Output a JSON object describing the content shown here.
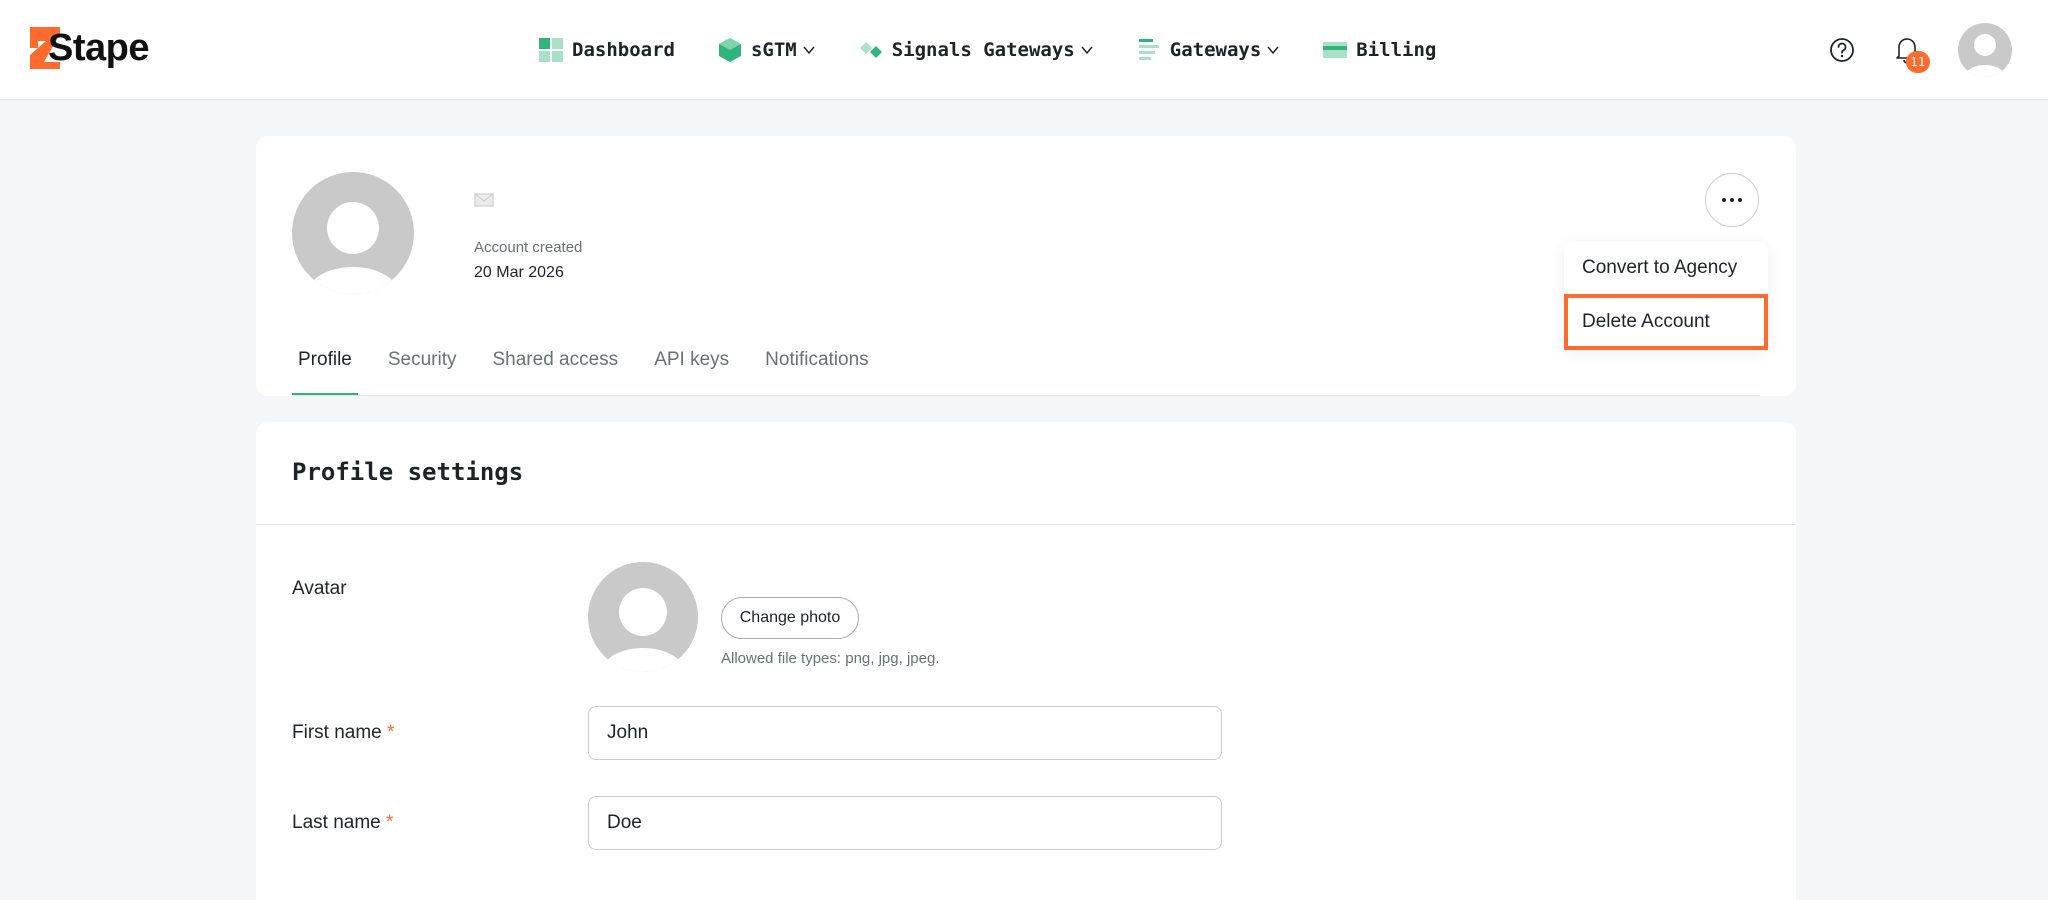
{
  "app": {
    "logo_text": "Stape"
  },
  "nav": {
    "items": [
      {
        "label": "Dashboard",
        "icon": "dashboard-icon",
        "dropdown": false
      },
      {
        "label": "sGTM",
        "icon": "cube-icon",
        "dropdown": true
      },
      {
        "label": "Signals Gateways",
        "icon": "signals-icon",
        "dropdown": true
      },
      {
        "label": "Gateways",
        "icon": "gateways-icon",
        "dropdown": true
      },
      {
        "label": "Billing",
        "icon": "card-icon",
        "dropdown": false
      }
    ]
  },
  "header": {
    "notification_count": "11",
    "account_created_label": "Account created",
    "account_created_date": "20 Mar 2026"
  },
  "menu": {
    "items": [
      {
        "label": "Convert to Agency"
      },
      {
        "label": "Delete Account"
      }
    ]
  },
  "tabs": [
    {
      "label": "Profile",
      "active": true
    },
    {
      "label": "Security",
      "active": false
    },
    {
      "label": "Shared access",
      "active": false
    },
    {
      "label": "API keys",
      "active": false
    },
    {
      "label": "Notifications",
      "active": false
    }
  ],
  "profile_settings": {
    "title": "Profile settings",
    "avatar_label": "Avatar",
    "change_photo_label": "Change photo",
    "allowed_types": "Allowed file types: png, jpg, jpeg.",
    "first_name_label": "First name",
    "first_name_value": "John",
    "last_name_label": "Last name",
    "last_name_value": "Doe",
    "required_mark": "*"
  },
  "colors": {
    "accent": "#ff6b2c",
    "tab_active": "#2fb47c"
  }
}
